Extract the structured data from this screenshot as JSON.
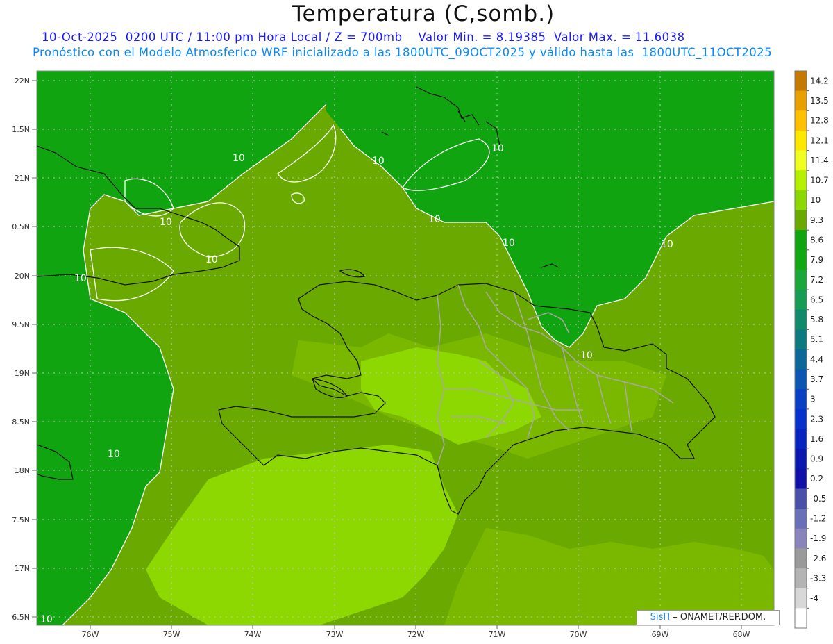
{
  "title": "Temperatura (C,somb.)",
  "subtitle_line1": "10-Oct-2025  0200 UTC / 11:00 pm Hora Local / Z = 700mb    Valor Min. = 8.19385  Valor Max. = 11.6038",
  "subtitle_line2": "Pronóstico con el Modelo Atmosferico WRF inicializado a las 1800UTC_09OCT2025 y válido hasta las  1800UTC_11OCT2025",
  "lat_labels": [
    "22N",
    "1.5N",
    "21N",
    "0.5N",
    "20N",
    "9.5N",
    "19N",
    "8.5N",
    "18N",
    "7.5N",
    "17N",
    "6.5N"
  ],
  "lon_labels": [
    "76W",
    "75W",
    "74W",
    "73W",
    "72W",
    "71W",
    "70W",
    "69W",
    "68W"
  ],
  "contour_labels": [
    "10",
    "10",
    "10",
    "10",
    "10",
    "10",
    "10",
    "10",
    "10",
    "10",
    "10",
    "10"
  ],
  "colorbar": {
    "labels": [
      "14.2",
      "13.5",
      "12.8",
      "12.1",
      "11.4",
      "10.7",
      "10",
      "9.3",
      "8.6",
      "7.9",
      "7.2",
      "6.5",
      "5.8",
      "5.1",
      "4.4",
      "3.7",
      "3",
      "2.3",
      "1.6",
      "0.9",
      "0.2",
      "-0.5",
      "-1.2",
      "-1.9",
      "-2.6",
      "-3.3",
      "-4"
    ],
    "colors": [
      "#c47a00",
      "#e8a000",
      "#ffc000",
      "#ffe800",
      "#f0ff20",
      "#b4f000",
      "#8cd800",
      "#6aaa00",
      "#10a410",
      "#12a814",
      "#1ca73a",
      "#169c55",
      "#108a6a",
      "#0d7a80",
      "#0c6898",
      "#0a56b0",
      "#0840c4",
      "#0632cc",
      "#0524c0",
      "#0a18b0",
      "#1010a8",
      "#4a50a8",
      "#6a70b8",
      "#8a84bc",
      "#9a9a9a",
      "#b4b4b4",
      "#d8d8d8",
      "#ffffff"
    ]
  },
  "map_colors": {
    "field_high": "#8cd800",
    "field_mid": "#7ab800",
    "field_base": "#6aaa00",
    "field_low": "#10a410",
    "coast": "#111111",
    "provinces": "#a8a8a8",
    "contour": "#ffffff",
    "grid": "#c8c8c8"
  },
  "credit": {
    "sis": "SisΠ",
    "rest": " – ONAMET/REP.DOM."
  }
}
